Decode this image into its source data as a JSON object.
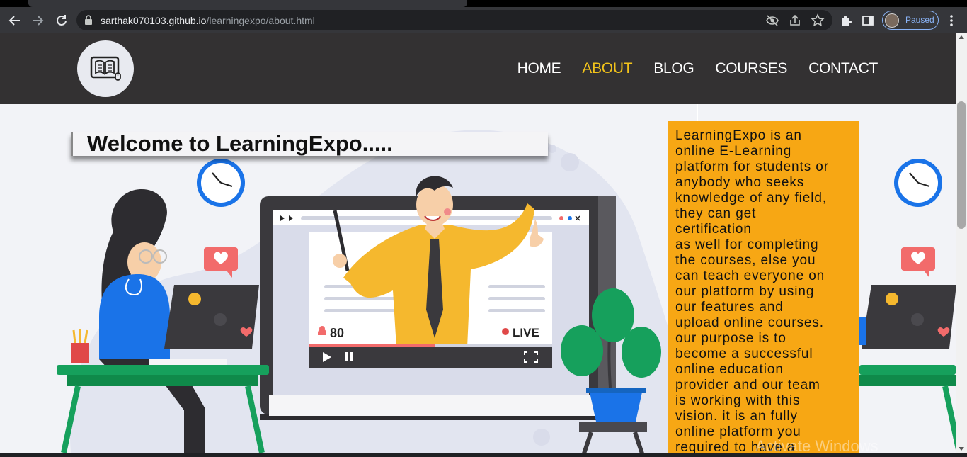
{
  "browser": {
    "url_domain": "sarthak070103.github.io",
    "url_path": "/learningexpo/about.html",
    "profile_label": "Paused"
  },
  "site": {
    "nav": [
      "HOME",
      "ABOUT",
      "BLOG",
      "COURSES",
      "CONTACT"
    ],
    "active_nav": "ABOUT",
    "accent_color": "#f2c31b",
    "header_color": "#333132",
    "about_box_color": "#f7a714"
  },
  "hero": {
    "welcome": "Welcome to LearningExpo.....",
    "video_viewers": "80",
    "video_status": "LIVE",
    "about_text_lines": [
      "LearningExpo is an",
      "online E-Learning",
      "platform for students or",
      "anybody who seeks",
      "knowledge of any field,",
      "they can get",
      "certification",
      "as well for completing",
      "the courses, else you",
      "can teach everyone on",
      "our platform by using",
      "our features and",
      "upload online courses.",
      "our purpose is to",
      "become a successful",
      "online education",
      "provider and our team",
      "is working with this",
      "vision. it is an fully",
      "online platform you",
      "required to have a"
    ]
  },
  "overlay": {
    "watermark": "Activate Windows"
  }
}
